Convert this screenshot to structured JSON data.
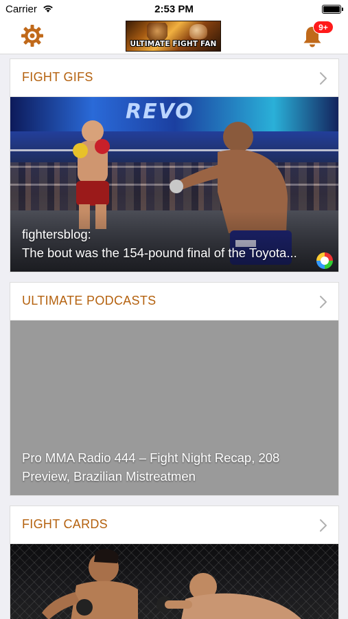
{
  "status_bar": {
    "carrier": "Carrier",
    "time": "2:53 PM",
    "wifi_icon": "wifi-icon",
    "battery_icon": "battery-icon"
  },
  "nav": {
    "settings_icon": "gear-icon",
    "logo_text": "ULTIMATE FIGHT FAN",
    "notifications_icon": "bell-icon",
    "notification_badge": "9+"
  },
  "colors": {
    "accent": "#b4610e",
    "badge": "#ff1a1a",
    "background": "#efeff4",
    "placeholder": "#9a9a9a"
  },
  "sections": [
    {
      "title": "FIGHT GIFS",
      "caption_lines": [
        "fightersblog:",
        "The bout was the 154-pound final of the Toyota..."
      ],
      "banner_text": "REVO"
    },
    {
      "title": "ULTIMATE PODCASTS",
      "caption_lines": [
        "Pro MMA Radio 444 – Fight Night Recap, 208",
        "Preview, Brazilian Mistreatmen"
      ]
    },
    {
      "title": "FIGHT CARDS",
      "caption_lines": []
    }
  ]
}
